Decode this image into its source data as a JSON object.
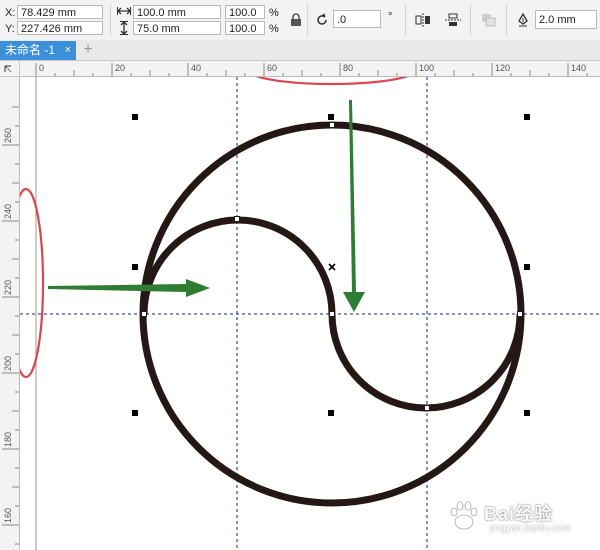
{
  "property_bar": {
    "x_label": "X:",
    "x_value": "78.429 mm",
    "y_label": "Y:",
    "y_value": "227.426 mm",
    "width_value": "100.0 mm",
    "height_value": "75.0 mm",
    "scale_x": "100.0",
    "scale_y": "100.0",
    "percent_x": "%",
    "percent_y": "%",
    "rotation_value": ".0",
    "rotation_unit": "°",
    "outline_width": "2.0 mm"
  },
  "tabs": [
    {
      "label": "未命名 -1",
      "close": "×"
    }
  ],
  "add_tab": "+",
  "ruler": {
    "h_ticks": [
      "0",
      "20",
      "40",
      "60",
      "80",
      "100",
      "120",
      "140"
    ],
    "v_ticks": [
      "260",
      "240",
      "220",
      "200",
      "180",
      "160"
    ]
  },
  "watermark": {
    "text": "Bai经验",
    "url": "jingyan.baidu.com"
  },
  "colors": {
    "tab_active": "#3c8fd9",
    "shape_stroke": "#231815",
    "arrow": "#2e7d32",
    "annotation_ellipse": "#d9474e"
  }
}
